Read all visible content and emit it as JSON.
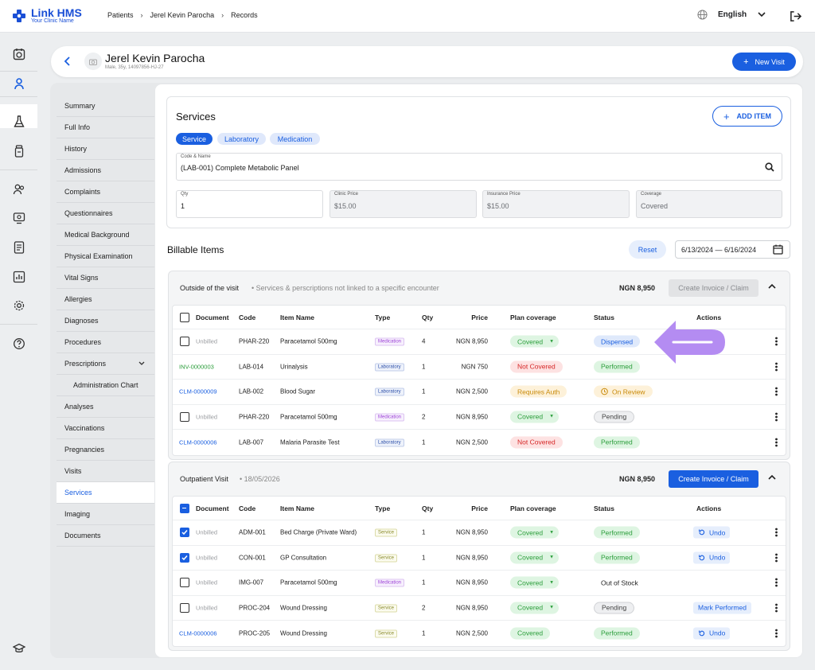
{
  "app": {
    "name": "Link HMS",
    "tagline": "Your Clinic Name"
  },
  "breadcrumb": [
    "Patients",
    "Jerel Kevin Parocha",
    "Records"
  ],
  "language": "English",
  "patient": {
    "name": "Jerel Kevin Parocha",
    "meta": "Male, 35y, 14097856-HJ-27"
  },
  "new_visit_label": "New Visit",
  "subnav": [
    {
      "label": "Summary"
    },
    {
      "label": "Full Info"
    },
    {
      "label": "History"
    },
    {
      "label": "Admissions"
    },
    {
      "label": "Complaints"
    },
    {
      "label": "Questionnaires"
    },
    {
      "label": "Medical Background"
    },
    {
      "label": "Physical Examination"
    },
    {
      "label": "Vital Signs"
    },
    {
      "label": "Allergies"
    },
    {
      "label": "Diagnoses"
    },
    {
      "label": "Procedures"
    },
    {
      "label": "Prescriptions"
    },
    {
      "label": "Administration Chart"
    },
    {
      "label": "Analyses"
    },
    {
      "label": "Vaccinations"
    },
    {
      "label": "Pregnancies"
    },
    {
      "label": "Visits"
    },
    {
      "label": "Services"
    },
    {
      "label": "Imaging"
    },
    {
      "label": "Documents"
    }
  ],
  "services": {
    "title": "Services",
    "add_item_label": "ADD ITEM",
    "tabs": [
      "Service",
      "Laboratory",
      "Medication"
    ],
    "active_tab": "Service",
    "code_name": {
      "label": "Code & Name",
      "value": "(LAB-001) Complete Metabolic Panel"
    },
    "qty": {
      "label": "Qty",
      "value": "1"
    },
    "clinic_price": {
      "label": "Clinic Price",
      "value": "$15.00"
    },
    "insurance_price": {
      "label": "Insurance Price",
      "value": "$15.00"
    },
    "coverage": {
      "label": "Coverage",
      "value": "Covered"
    }
  },
  "billable": {
    "title": "Billable Items",
    "reset_label": "Reset",
    "date_range": "6/13/2024 — 6/16/2024",
    "columns": [
      "Document",
      "Code",
      "Item Name",
      "Type",
      "Qty",
      "Price",
      "Plan coverage",
      "Status",
      "Actions"
    ]
  },
  "groups": [
    {
      "title": "Outside of the visit",
      "subtitle": "•  Services & perscriptions not linked to a specific encounter",
      "total": "NGN 8,950",
      "invoice_label": "Create Invoice / Claim",
      "invoice_enabled": false,
      "rows": [
        {
          "document": "Unbilled",
          "doc_kind": "unbilled",
          "checkbox": true,
          "checked": false,
          "code": "PHAR-220",
          "name": "Paracetamol 500mg",
          "type": "Medication",
          "qty": "4",
          "price": "NGN 8,950",
          "coverage": "Covered",
          "coverage_dropdown": true,
          "status": "Dispensed",
          "action": ""
        },
        {
          "document": "INV-0000003",
          "doc_kind": "invoice",
          "checkbox": false,
          "checked": false,
          "code": "LAB-014",
          "name": "Urinalysis",
          "type": "Laboratory",
          "qty": "1",
          "price": "NGN 750",
          "coverage": "Not Covered",
          "coverage_dropdown": false,
          "status": "Performed",
          "action": ""
        },
        {
          "document": "CLM-0000009",
          "doc_kind": "claim",
          "checkbox": false,
          "checked": false,
          "code": "LAB-002",
          "name": "Blood Sugar",
          "type": "Laboratory",
          "qty": "1",
          "price": "NGN 2,500",
          "coverage": "Requires Auth",
          "coverage_dropdown": false,
          "status": "On Review",
          "action": ""
        },
        {
          "document": "Unbilled",
          "doc_kind": "unbilled",
          "checkbox": true,
          "checked": false,
          "code": "PHAR-220",
          "name": "Paracetamol 500mg",
          "type": "Medication",
          "qty": "2",
          "price": "NGN 8,950",
          "coverage": "Covered",
          "coverage_dropdown": true,
          "status": "Pending",
          "action": ""
        },
        {
          "document": "CLM-0000006",
          "doc_kind": "claim",
          "checkbox": false,
          "checked": false,
          "code": "LAB-007",
          "name": "Malaria Parasite Test",
          "type": "Laboratory",
          "qty": "1",
          "price": "NGN 2,500",
          "coverage": "Not Covered",
          "coverage_dropdown": false,
          "status": "Performed",
          "action": ""
        }
      ]
    },
    {
      "title": "Outpatient Visit",
      "subtitle": "•  18/05/2026",
      "total": "NGN 8,950",
      "invoice_label": "Create Invoice / Claim",
      "invoice_enabled": true,
      "rows": [
        {
          "document": "Unbilled",
          "doc_kind": "unbilled",
          "checkbox": true,
          "checked": true,
          "code": "ADM-001",
          "name": "Bed Charge (Private Ward)",
          "type": "Service",
          "qty": "1",
          "price": "NGN 8,950",
          "coverage": "Covered",
          "coverage_dropdown": true,
          "status": "Performed",
          "action": "Undo"
        },
        {
          "document": "Unbilled",
          "doc_kind": "unbilled",
          "checkbox": true,
          "checked": true,
          "code": "CON-001",
          "name": "GP Consultation",
          "type": "Service",
          "qty": "1",
          "price": "NGN 8,950",
          "coverage": "Covered",
          "coverage_dropdown": true,
          "status": "Performed",
          "action": "Undo"
        },
        {
          "document": "Unbilled",
          "doc_kind": "unbilled",
          "checkbox": true,
          "checked": false,
          "code": "IMG-007",
          "name": "Paracetamol 500mg",
          "type": "Medication",
          "qty": "1",
          "price": "NGN 8,950",
          "coverage": "Covered",
          "coverage_dropdown": true,
          "status": "Out of Stock",
          "action": ""
        },
        {
          "document": "Unbilled",
          "doc_kind": "unbilled",
          "checkbox": true,
          "checked": false,
          "code": "PROC-204",
          "name": "Wound Dressing",
          "type": "Service",
          "qty": "2",
          "price": "NGN 8,950",
          "coverage": "Covered",
          "coverage_dropdown": true,
          "status": "Pending",
          "action": "Mark Performed"
        },
        {
          "document": "CLM-0000006",
          "doc_kind": "claim",
          "checkbox": false,
          "checked": false,
          "code": "PROC-205",
          "name": "Wound Dressing",
          "type": "Service",
          "qty": "1",
          "price": "NGN 2,500",
          "coverage": "Covered",
          "coverage_dropdown": false,
          "status": "Performed",
          "action": "Undo"
        }
      ]
    }
  ],
  "colors": {
    "accent": "#1a5fe0",
    "success": "#2a9d3a",
    "danger": "#d62828",
    "warning": "#c98a0a",
    "highlight_arrow": "#b48cf2"
  }
}
